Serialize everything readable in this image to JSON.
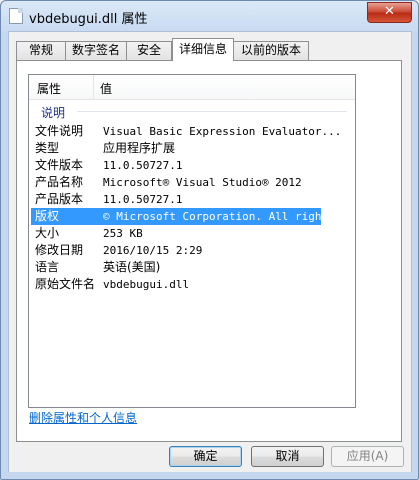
{
  "window": {
    "title": "vbdebugui.dll 属性",
    "close_glyph": "✕"
  },
  "tabs": [
    {
      "label": "常规"
    },
    {
      "label": "数字签名"
    },
    {
      "label": "安全"
    },
    {
      "label": "详细信息"
    },
    {
      "label": "以前的版本"
    }
  ],
  "list": {
    "col_property": "属性",
    "col_value": "值",
    "group": "说明",
    "rows": [
      {
        "key": "文件说明",
        "value": "Visual Basic Expression Evaluator..."
      },
      {
        "key": "类型",
        "value": "应用程序扩展"
      },
      {
        "key": "文件版本",
        "value": "11.0.50727.1"
      },
      {
        "key": "产品名称",
        "value": "Microsoft® Visual Studio® 2012"
      },
      {
        "key": "产品版本",
        "value": "11.0.50727.1"
      },
      {
        "key": "版权",
        "value": "© Microsoft Corporation. All righ..."
      },
      {
        "key": "大小",
        "value": "253 KB"
      },
      {
        "key": "修改日期",
        "value": "2016/10/15 2:29"
      },
      {
        "key": "语言",
        "value": "英语(美国)"
      },
      {
        "key": "原始文件名",
        "value": "vbdebugui.dll"
      }
    ]
  },
  "link": {
    "remove_info": "删除属性和个人信息"
  },
  "buttons": {
    "ok": "确定",
    "cancel": "取消",
    "apply": "应用(A)"
  },
  "colors": {
    "selection": "#3399ff",
    "link": "#0066cc",
    "group": "#1e3287"
  }
}
